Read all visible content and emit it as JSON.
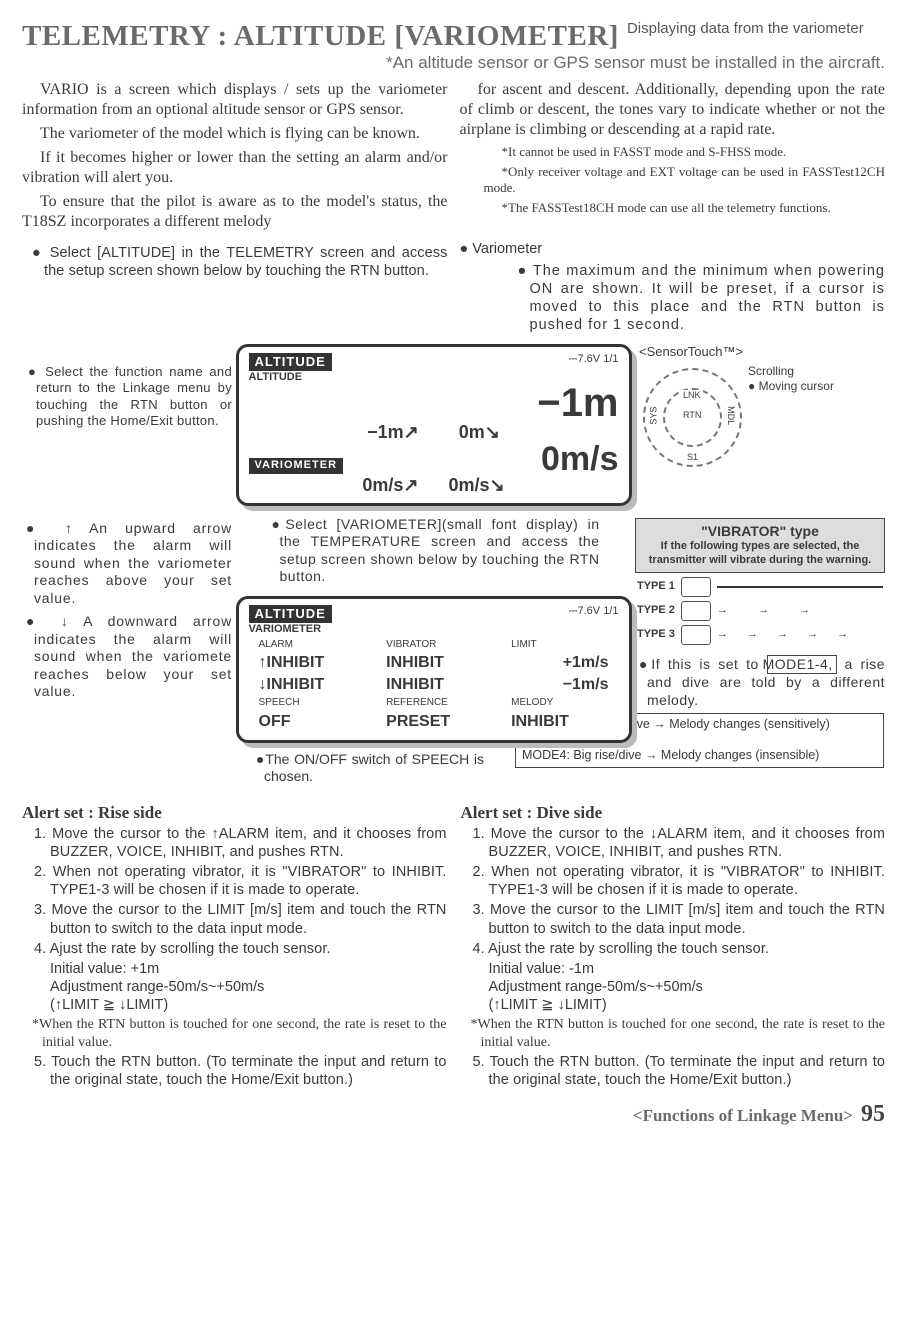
{
  "header": {
    "title": "TELEMETRY : ALTITUDE [VARIOMETER]",
    "side": "Displaying data from the variometer",
    "subtitle": "*An altitude sensor or GPS sensor must be installed in the aircraft."
  },
  "intro_left": {
    "p1": "VARIO is a screen which displays / sets up the variometer information from an optional altitude sensor or GPS sensor.",
    "p2": "The variometer of the model which is flying can be known.",
    "p3": "If it becomes higher or lower than the setting  an alarm and/or vibration will alert you.",
    "p4": "To ensure that the pilot is aware as to the model's status, the T18SZ  incorporates a different melody"
  },
  "intro_right": {
    "p1": "for ascent and descent.  Additionally, depending upon the rate of climb or descent, the tones vary to indicate whether or not the airplane is climbing or descending at a rapid rate.",
    "s1": "*It cannot be used in FASST mode and S-FHSS mode.",
    "s2": "*Only receiver voltage and EXT voltage can be used in FASSTest12CH mode.",
    "s3": "*The FASSTest18CH mode can use all the telemetry functions."
  },
  "mid": {
    "select_altitude": "● Select [ALTITUDE] in the TELEMETRY screen and access the setup screen shown below by touching the RTN button.",
    "select_function": "● Select the function name and return to the Linkage menu by touching the RTN button or pushing the Home/Exit button.",
    "vario_head": "● Variometer",
    "vario_max": "● The maximum and the minimum when powering ON are shown. It will be preset, if a cursor is moved to this place and the RTN button is pushed for 1 second.",
    "sensor_touch": "<SensorTouch™>",
    "scrolling": "Scrolling",
    "moving_cursor": "● Moving cursor",
    "ring_LNK": "LNK",
    "ring_RTN": "RTN",
    "ring_SYS": "SYS",
    "ring_MDL": "MDL",
    "ring_S1": "S1",
    "up_arrow": "● ↑ An upward arrow indicates the alarm will sound when the variometer reaches above your set value.",
    "down_arrow": "● ↓ A downward arrow indicates the alarm will sound when the variomete reaches below your set value.",
    "select_vario": "●Select [VARIOMETER](small font display) in the TEMPERATURE screen and access the setup screen shown below by touching the RTN button.",
    "speech": "●The ON/OFF switch of SPEECH is chosen.",
    "mode_set": "●If this is set to",
    "mode_ref": "MODE1-4,",
    "mode_tail": "a rise and dive are told by a different melody.",
    "mode1": "MODE1: Little rise/dive → Melody changes (sensitively)",
    "mode_dots": "⋮",
    "mode4": "MODE4: Big rise/dive → Melody changes (insensible)"
  },
  "lcd1": {
    "title": "ALTITUDE",
    "batt": "⎓7.6V 1/1",
    "sub": "ALTITUDE",
    "big": "−1m",
    "mid_left": "−1m↗",
    "mid_right": "0m↘",
    "vario_label": "VARIOMETER",
    "vario_big": "0m/s",
    "foot_left": "0m/s↗",
    "foot_right": "0m/s↘"
  },
  "lcd2": {
    "title": "ALTITUDE",
    "batt": "⎓7.6V 1/1",
    "sub": "VARIOMETER",
    "h_alarm": "ALARM",
    "h_vib": "VIBRATOR",
    "h_limit": "LIMIT",
    "r1_a": "↑INHIBIT",
    "r1_b": "INHIBIT",
    "r1_c": "+1m/s",
    "r2_a": "↓INHIBIT",
    "r2_b": "INHIBIT",
    "r2_c": "−1m/s",
    "h_speech": "SPEECH",
    "h_ref": "REFERENCE",
    "h_mel": "MELODY",
    "v_speech": "OFF",
    "v_ref": "PRESET",
    "v_mel": "INHIBIT"
  },
  "vibrator": {
    "title": "\"VIBRATOR\" type",
    "sub": "If the following types are selected, the transmitter will vibrate during the warning.",
    "t1": "TYPE 1",
    "t2": "TYPE 2",
    "t3": "TYPE 3"
  },
  "alerts": {
    "rise_title": "Alert set : Rise side",
    "dive_title": "Alert set : Dive side",
    "rise": {
      "s1": "1. Move the cursor to the ↑ALARM  item, and it chooses from BUZZER, VOICE, INHIBIT, and pushes RTN.",
      "s2": "2. When not operating vibrator, it is \"VIBRATOR\" to INHIBIT. TYPE1-3 will be chosen if it is made to operate.",
      "s3": "3. Move the cursor to the LIMIT [m/s] item and touch the RTN button to switch to the data input mode.",
      "s4": "4. Ajust the rate by scrolling the touch sensor.",
      "s4a": "Initial value: +1m",
      "s4b": "Adjustment range-50m/s~+50m/s",
      "s4c": "(↑LIMIT ≧ ↓LIMIT)",
      "note": "*When the RTN button is touched for one second, the rate is reset to the initial value.",
      "s5": "5. Touch the RTN button. (To terminate the input and return to the original state, touch the Home/Exit button.)"
    },
    "dive": {
      "s1": "1. Move the cursor to the ↓ALARM  item, and it chooses from BUZZER, VOICE, INHIBIT, and pushes RTN.",
      "s2": "2. When not operating vibrator, it is \"VIBRATOR\" to INHIBIT. TYPE1-3 will be chosen if it is made to operate.",
      "s3": "3. Move the cursor to the LIMIT [m/s] item and touch the RTN button to switch to the data input mode.",
      "s4": "4. Ajust the rate by scrolling the touch sensor.",
      "s4a": "Initial value: -1m",
      "s4b": "Adjustment range-50m/s~+50m/s",
      "s4c": "(↑LIMIT ≧ ↓LIMIT)",
      "note": "*When the RTN button is touched for one second, the rate is reset to the initial value.",
      "s5": "5. Touch the RTN button. (To terminate the input and return to the original state, touch the Home/Exit button.)"
    }
  },
  "footer": {
    "label": "<Functions of Linkage Menu>",
    "page": "95"
  }
}
